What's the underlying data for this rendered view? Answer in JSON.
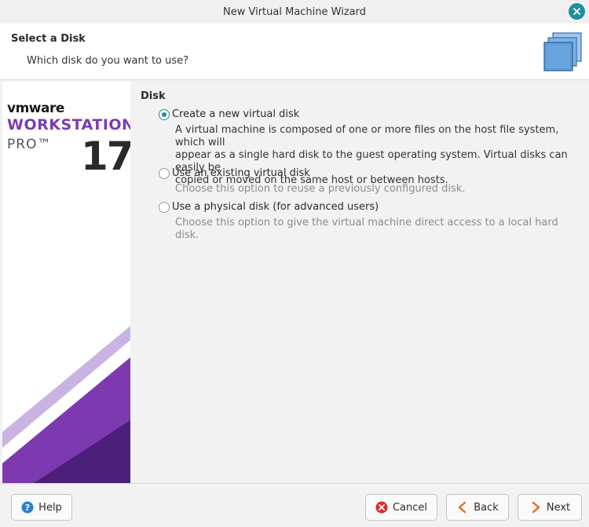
{
  "window": {
    "title": "New Virtual Machine Wizard",
    "close_icon": "close-icon"
  },
  "header": {
    "title": "Select a Disk",
    "subtitle": "Which disk do you want to use?",
    "icon": "disks-icon"
  },
  "sidebar": {
    "brand": "vmware",
    "product": "WORKSTATION",
    "edition": "PRO™",
    "version": "17",
    "colors": {
      "purple": "#7d3ab0",
      "dark_purple": "#4b1f7a"
    }
  },
  "disk": {
    "section_label": "Disk",
    "options": [
      {
        "label": "Create a new virtual disk",
        "selected": true,
        "description_lines": [
          "A virtual machine is composed of one or more files on the host file system, which will",
          "appear as a single hard disk to the guest operating system. Virtual disks can easily be",
          "copied or moved on the same host or between hosts."
        ]
      },
      {
        "label": "Use an existing virtual disk",
        "selected": false,
        "description_lines": [
          "Choose this option to reuse a previously configured disk."
        ]
      },
      {
        "label": "Use a physical disk (for advanced users)",
        "selected": false,
        "description_lines": [
          "Choose this option to give the virtual machine direct access to a local hard disk."
        ]
      }
    ]
  },
  "footer": {
    "help_label": "Help",
    "cancel_label": "Cancel",
    "back_label": "Back",
    "next_label": "Next"
  },
  "colors": {
    "accent": "#1e8f9e",
    "cancel_red": "#d32f2f",
    "arrow_orange": "#e06b1c",
    "help_blue": "#2f7fd1"
  }
}
